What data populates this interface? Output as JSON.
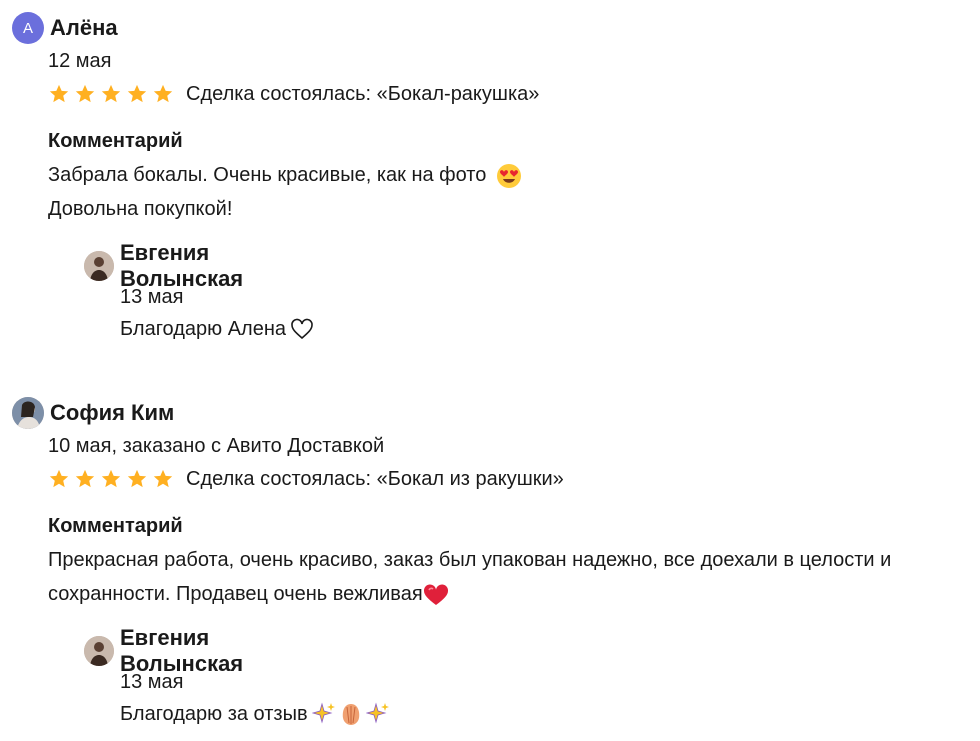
{
  "reviews": [
    {
      "author": "Алёна",
      "avatar_letter": "А",
      "date": "12 мая",
      "rating": 5,
      "deal": "Сделка состоялась: «Бокал-ракушка»",
      "comment_title": "Комментарий",
      "comment_lines": [
        "Забрала бокалы. Очень красивые, как на фото",
        "Довольна покупкой!"
      ],
      "comment_emoji": "heart-eyes-emoji",
      "reply": {
        "author": "Евгения Волынская",
        "date": "13 мая",
        "text": "Благодарю Алена",
        "emoji": "white-heart-icon"
      }
    },
    {
      "author": "София Ким",
      "date": "10 мая, заказано с Авито Доставкой",
      "rating": 5,
      "deal": "Сделка состоялась: «Бокал из ракушки»",
      "comment_title": "Комментарий",
      "comment_text": "Прекрасная работа, очень красиво, заказ был упакован надежно, все доехали в целости и сохранности. Продавец очень вежливая",
      "comment_emoji": "red-heart-icon",
      "reply": {
        "author": "Евгения Волынская",
        "date": "13 мая",
        "text": "Благодарю за отзыв",
        "emoji": "sparkles-shell-sparkles"
      }
    }
  ],
  "colors": {
    "star": "#ffb021",
    "avatar_letter_bg": "#6b6fdc",
    "text": "#1a1a1a"
  }
}
